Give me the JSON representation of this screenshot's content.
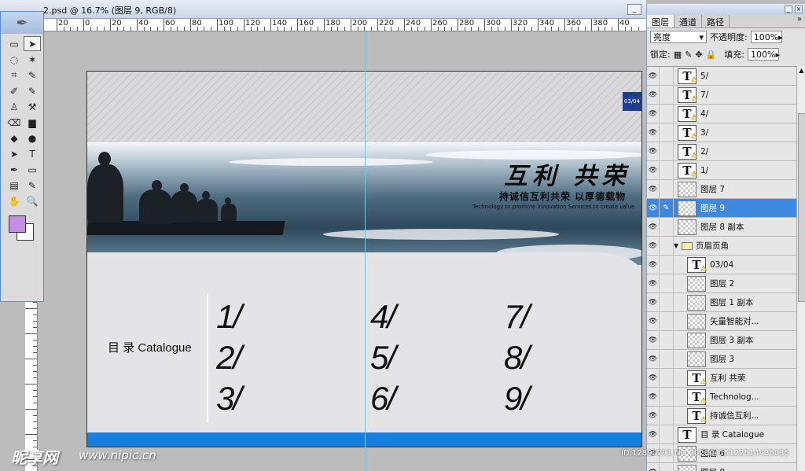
{
  "window": {
    "title": "2.psd @ 16.7% (图层 9, RGB/8)",
    "minimize": "_"
  },
  "ruler": {
    "h_labels": [
      "20",
      "0",
      "20",
      "40",
      "60",
      "80",
      "100",
      "120",
      "140",
      "160",
      "180",
      "200",
      "220",
      "240",
      "260",
      "280",
      "300",
      "320",
      "340",
      "360",
      "380",
      "40"
    ]
  },
  "tools": {
    "rows": [
      [
        "▭",
        "➤"
      ],
      [
        "◌",
        "✶"
      ],
      [
        "⌗",
        "✎"
      ],
      [
        "✐",
        "✎"
      ],
      [
        "♙",
        "⚒"
      ],
      [
        "⌫",
        "▆"
      ],
      [
        "◆",
        "●"
      ],
      [
        "➤",
        "T"
      ],
      [
        "✒",
        "▭"
      ],
      [
        "▤",
        "✎"
      ],
      [
        "✋",
        "🔍"
      ]
    ],
    "fg_color": "#c38de8",
    "bg_color": "#ffffff"
  },
  "document": {
    "page_number": "03/04",
    "slogan_cn": "互利 共荣",
    "slogan_sub": "持诚信互利共荣 以厚德载物",
    "slogan_en": "Technology to promote Innovation Services to create value",
    "catalogue_label": "目 录 Catalogue",
    "numbers": [
      "1/",
      "2/",
      "3/",
      "4/",
      "5/",
      "6/",
      "7/",
      "8/",
      "9/"
    ],
    "accent_color": "#1580df"
  },
  "layers_panel": {
    "tabs": [
      "图层",
      "通道",
      "路径"
    ],
    "more": "»",
    "blend_mode": "亮度",
    "opacity_label": "不透明度:",
    "opacity_value": "100%",
    "lock_label": "锁定:",
    "fill_label": "填充:",
    "fill_value": "100%",
    "layers": [
      {
        "name": "5/",
        "kind": "text-warn"
      },
      {
        "name": "7/",
        "kind": "text-warn"
      },
      {
        "name": "4/",
        "kind": "text-warn"
      },
      {
        "name": "3/",
        "kind": "text-warn"
      },
      {
        "name": "2/",
        "kind": "text-warn"
      },
      {
        "name": "1/",
        "kind": "text-warn"
      },
      {
        "name": "图层 7",
        "kind": "raster"
      },
      {
        "name": "图层 9",
        "kind": "raster",
        "selected": true
      },
      {
        "name": "图层 8 副本",
        "kind": "raster"
      },
      {
        "name": "页眉页角",
        "kind": "group"
      },
      {
        "name": "03/04",
        "kind": "text-warn",
        "indent": true
      },
      {
        "name": "图层 2",
        "kind": "raster",
        "indent": true
      },
      {
        "name": "图层 1 副本",
        "kind": "raster",
        "indent": true
      },
      {
        "name": "矢量智能对...",
        "kind": "raster",
        "indent": true
      },
      {
        "name": "图层 3 副本",
        "kind": "raster",
        "indent": true
      },
      {
        "name": "图层 3",
        "kind": "raster",
        "indent": true
      },
      {
        "name": "互利 共荣",
        "kind": "text-warn",
        "indent": true
      },
      {
        "name": "Technolog...",
        "kind": "text-warn",
        "indent": true
      },
      {
        "name": "持诚信互利...",
        "kind": "text-warn",
        "indent": true
      },
      {
        "name": "目 录 Catalogue",
        "kind": "text"
      },
      {
        "name": "图层 6",
        "kind": "raster"
      },
      {
        "name": "图层 8",
        "kind": "raster"
      }
    ]
  },
  "watermark": {
    "logo": "昵享网",
    "url": "www.nipic.cn",
    "id": "ID:12890291 NO:20200415122514435035"
  }
}
